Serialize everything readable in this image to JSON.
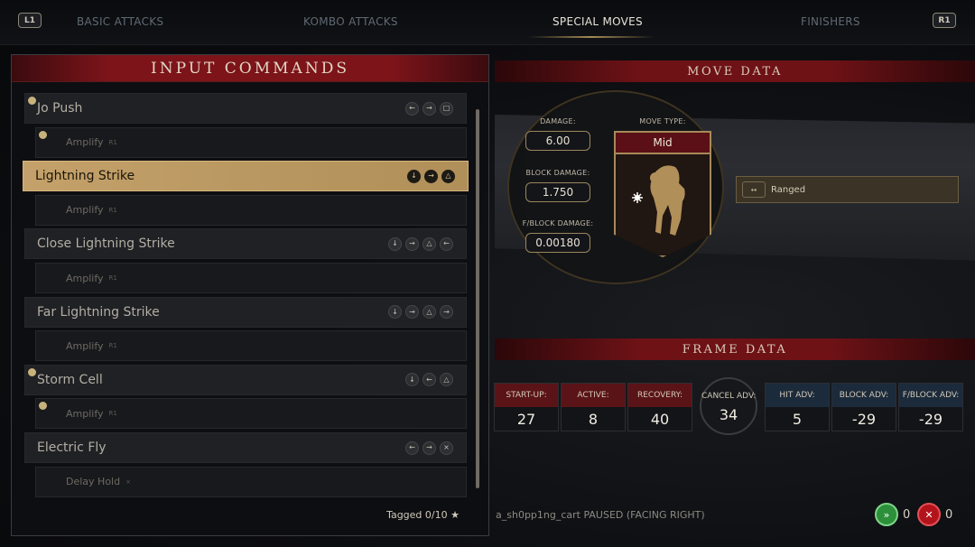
{
  "tabs": {
    "left_shoulder": "L1",
    "right_shoulder": "R1",
    "items": [
      "BASIC ATTACKS",
      "KOMBO ATTACKS",
      "SPECIAL MOVES",
      "FINISHERS"
    ],
    "active_index": 2
  },
  "input_commands": {
    "title": "INPUT COMMANDS",
    "moves": [
      {
        "name": "Jo Push",
        "tagged": true,
        "inputs": [
          "left-arrow",
          "right-arrow",
          "square"
        ]
      },
      {
        "name": "Amplify",
        "sub": true,
        "tagged": true,
        "badge": "R1"
      },
      {
        "name": "Lightning Strike",
        "selected": true,
        "inputs": [
          "down-arrow",
          "right-arrow",
          "triangle"
        ]
      },
      {
        "name": "Amplify",
        "sub": true,
        "badge": "R1"
      },
      {
        "name": "Close Lightning Strike",
        "inputs": [
          "down-arrow",
          "right-arrow",
          "triangle",
          "left-arrow"
        ]
      },
      {
        "name": "Amplify",
        "sub": true,
        "badge": "R1"
      },
      {
        "name": "Far Lightning Strike",
        "inputs": [
          "down-arrow",
          "right-arrow",
          "triangle",
          "right-arrow"
        ]
      },
      {
        "name": "Amplify",
        "sub": true,
        "badge": "R1"
      },
      {
        "name": "Storm Cell",
        "tagged": true,
        "inputs": [
          "down-arrow",
          "left-arrow",
          "triangle"
        ]
      },
      {
        "name": "Amplify",
        "sub": true,
        "tagged": true,
        "badge": "R1"
      },
      {
        "name": "Electric Fly",
        "inputs": [
          "left-arrow",
          "right-arrow",
          "cross"
        ]
      },
      {
        "name": "Delay Hold",
        "sub": true,
        "badge": "×"
      }
    ],
    "tagged_label": "Tagged 0/10",
    "tagged_icon": "★"
  },
  "move_data": {
    "title": "MOVE DATA",
    "damage_label": "DAMAGE:",
    "damage": "6.00",
    "block_damage_label": "BLOCK DAMAGE:",
    "block_damage": "1.750",
    "fblock_damage_label": "F/BLOCK DAMAGE:",
    "fblock_damage": "0.00180",
    "move_type_label": "MOVE TYPE:",
    "move_type": "Mid",
    "property": "Ranged"
  },
  "frame_data": {
    "title": "FRAME DATA",
    "startup_label": "START-UP:",
    "startup": "27",
    "active_label": "ACTIVE:",
    "active": "8",
    "recovery_label": "RECOVERY:",
    "recovery": "40",
    "cancel_label": "CANCEL ADV:",
    "cancel": "34",
    "hit_label": "HIT ADV:",
    "hit": "5",
    "block_label": "BLOCK ADV:",
    "block": "-29",
    "fblock_label": "F/BLOCK ADV:",
    "fblock": "-29"
  },
  "status": {
    "text": "a_sh0pp1ng_cart PAUSED (FACING RIGHT)",
    "green_count": "0",
    "red_count": "0"
  },
  "colors": {
    "gold": "#c4a16a",
    "red_header": "#7c141a",
    "blue_label": "#1c2b3b"
  }
}
